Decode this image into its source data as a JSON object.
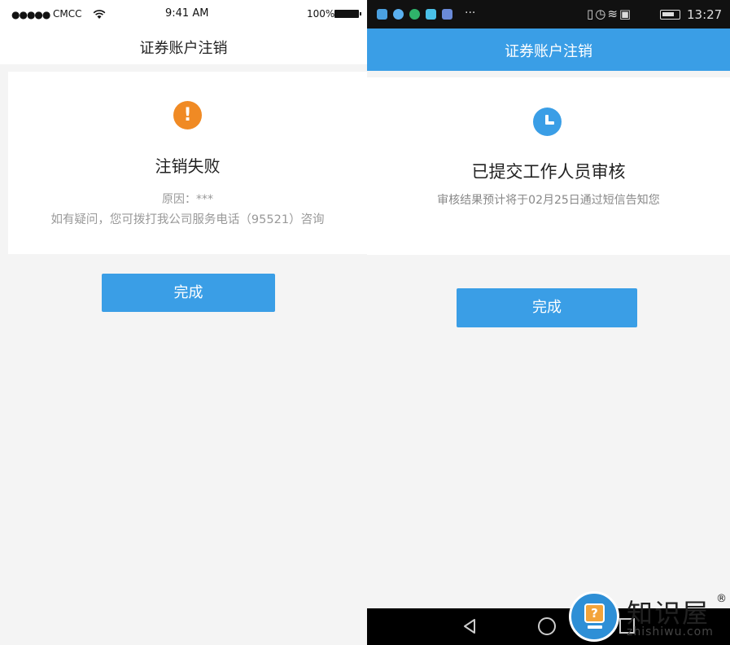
{
  "ios_screen": {
    "status_bar": {
      "signal": "●●●●●",
      "carrier": "CMCC",
      "time": "9:41 AM",
      "battery": "100%"
    },
    "nav_title": "证券账户注销",
    "result": {
      "icon": "warning-icon",
      "icon_color": "#f08a24",
      "title": "注销失败",
      "reason": "原因：***",
      "contact": "如有疑问，您可拨打我公司服务电话（95521）咨询"
    },
    "done_button": "完成"
  },
  "android_screen": {
    "status_bar": {
      "dots": "···",
      "time": "13:27"
    },
    "nav_title": "证券账户注销",
    "result": {
      "icon": "clock-icon",
      "icon_color": "#3a9ee6",
      "title": "已提交工作人员审核",
      "note": "审核结果预计将于02月25日通过短信告知您"
    },
    "done_button": "完成"
  },
  "watermark": {
    "brand": "知识屋",
    "registered": "®",
    "url": "zhishiwu.com"
  },
  "colors": {
    "accent": "#3a9ee6",
    "warning": "#f08a24",
    "page_bg": "#f4f4f4"
  }
}
